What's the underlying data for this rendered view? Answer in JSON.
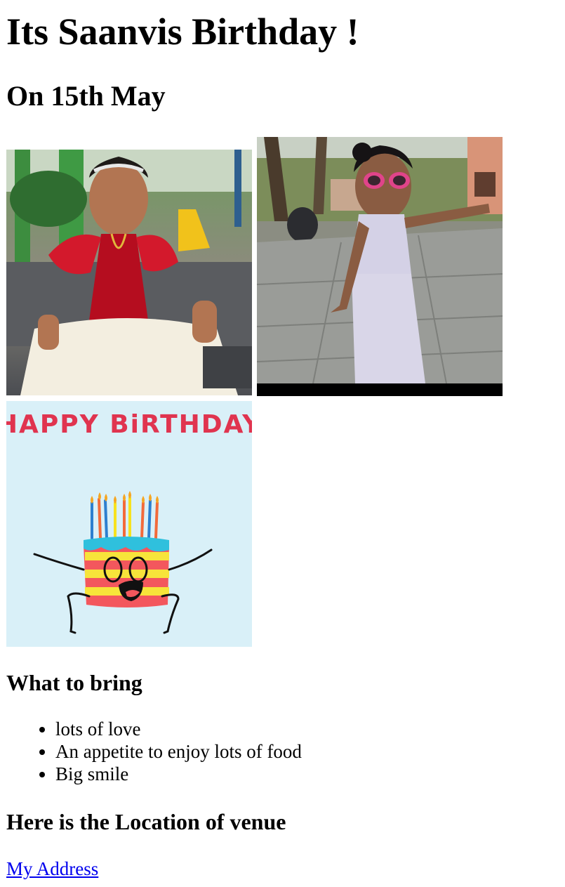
{
  "page": {
    "title": "Its Saanvis Birthday !",
    "date": "On 15th May"
  },
  "photos": [
    {
      "name": "photo-saanvi-red-dress"
    },
    {
      "name": "photo-saanvi-sunglasses"
    }
  ],
  "card": {
    "text": "HAPPY BiRTHDAY",
    "text_color": "#e0344f",
    "background": "#d9f0f8"
  },
  "bring": {
    "heading": "What to bring",
    "items": [
      "lots of love",
      "An appetite to enjoy lots of food",
      "Big smile"
    ]
  },
  "venue": {
    "heading": "Here is the Location of venue",
    "link_label": "My Address",
    "link_color": "#0000ee"
  }
}
